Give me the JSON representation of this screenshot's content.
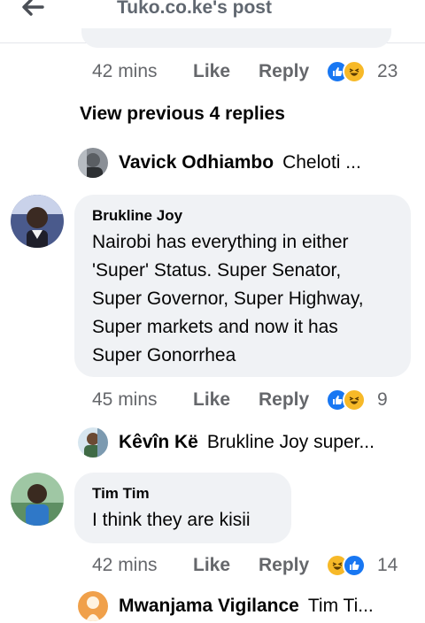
{
  "header": {
    "title": "Tuko.co.ke's post"
  },
  "comments": [
    {
      "time": "42 mins",
      "like_label": "Like",
      "reply_label": "Reply",
      "reactions": [
        "like-icon",
        "haha-icon"
      ],
      "count": "23"
    },
    {
      "author": "Brukline Joy",
      "text": "Nairobi has everything in either\n'Super' Status. Super Senator,\nSuper Governor, Super Highway,\nSuper markets and now it has\nSuper Gonorrhea",
      "time": "45 mins",
      "like_label": "Like",
      "reply_label": "Reply",
      "reactions": [
        "like-icon",
        "haha-icon"
      ],
      "count": "9"
    },
    {
      "author": "Tim Tim",
      "text": "I think they are kisii",
      "time": "42 mins",
      "like_label": "Like",
      "reply_label": "Reply",
      "reactions": [
        "haha-icon",
        "like-icon"
      ],
      "count": "14"
    }
  ],
  "view_previous": "View previous 4 replies",
  "reply_previews": [
    {
      "name": "Vavick Odhiambo",
      "text": "Cheloti ..."
    },
    {
      "name": "Kêvîn Kë",
      "text": "Brukline Joy super..."
    },
    {
      "name": "Mwanjama Vigilance",
      "text": "Tim Ti..."
    }
  ],
  "colors": {
    "like_blue": "#1877f2",
    "haha_yellow": "#f7b928",
    "bubble_gray": "#f0f2f5",
    "meta_gray": "#65676b"
  }
}
